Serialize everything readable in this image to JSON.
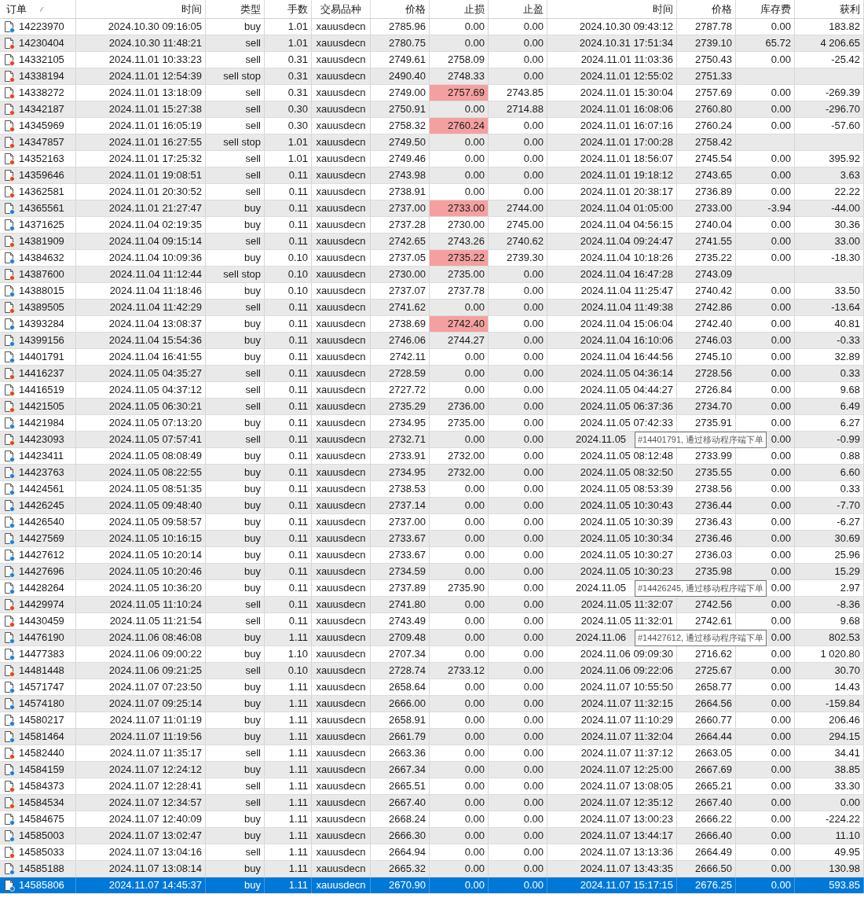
{
  "columns": [
    {
      "label": "订单"
    },
    {
      "label": "时间"
    },
    {
      "label": "类型"
    },
    {
      "label": "手数"
    },
    {
      "label": "交易品种"
    },
    {
      "label": "价格"
    },
    {
      "label": "止损"
    },
    {
      "label": "止盈"
    },
    {
      "label": "时间"
    },
    {
      "label": "价格"
    },
    {
      "label": "库存费"
    },
    {
      "label": "获利"
    }
  ],
  "rows": [
    {
      "kind": "buy",
      "selected": false,
      "sl_hit": false,
      "order": "14223970",
      "open_time": "2024.10.30 09:16:05",
      "type": "buy",
      "volume": "1.01",
      "symbol": "xauusdecn",
      "open_price": "2785.96",
      "sl": "0.00",
      "tp": "0.00",
      "close_time": "2024.10.30 09:43:12",
      "close_price": "2787.78",
      "swap": "0.00",
      "profit": "183.82"
    },
    {
      "kind": "sell",
      "selected": false,
      "sl_hit": false,
      "order": "14230404",
      "open_time": "2024.10.30 11:48:21",
      "type": "sell",
      "volume": "1.01",
      "symbol": "xauusdecn",
      "open_price": "2780.75",
      "sl": "0.00",
      "tp": "0.00",
      "close_time": "2024.10.31 17:51:34",
      "close_price": "2739.10",
      "swap": "65.72",
      "profit": "4 206.65"
    },
    {
      "kind": "sell",
      "selected": false,
      "sl_hit": false,
      "order": "14332105",
      "open_time": "2024.11.01 10:33:23",
      "type": "sell",
      "volume": "0.31",
      "symbol": "xauusdecn",
      "open_price": "2749.61",
      "sl": "2758.09",
      "tp": "0.00",
      "close_time": "2024.11.01 11:03:36",
      "close_price": "2750.43",
      "swap": "0.00",
      "profit": "-25.42"
    },
    {
      "kind": "sell",
      "selected": false,
      "sl_hit": false,
      "order": "14338194",
      "open_time": "2024.11.01 12:54:39",
      "type": "sell stop",
      "volume": "0.31",
      "symbol": "xauusdecn",
      "open_price": "2490.40",
      "sl": "2748.33",
      "tp": "0.00",
      "close_time": "2024.11.01 12:55:02",
      "close_price": "2751.33"
    },
    {
      "kind": "sell",
      "selected": false,
      "sl_hit": true,
      "order": "14338272",
      "open_time": "2024.11.01 13:18:09",
      "type": "sell",
      "volume": "0.31",
      "symbol": "xauusdecn",
      "open_price": "2749.00",
      "sl": "2757.69",
      "tp": "2743.85",
      "close_time": "2024.11.01 15:30:04",
      "close_price": "2757.69",
      "swap": "0.00",
      "profit": "-269.39"
    },
    {
      "kind": "sell",
      "selected": false,
      "sl_hit": false,
      "order": "14342187",
      "open_time": "2024.11.01 15:27:38",
      "type": "sell",
      "volume": "0.30",
      "symbol": "xauusdecn",
      "open_price": "2750.91",
      "sl": "0.00",
      "tp": "2714.88",
      "close_time": "2024.11.01 16:08:06",
      "close_price": "2760.80",
      "swap": "0.00",
      "profit": "-296.70"
    },
    {
      "kind": "sell",
      "selected": false,
      "sl_hit": true,
      "order": "14345969",
      "open_time": "2024.11.01 16:05:19",
      "type": "sell",
      "volume": "0.30",
      "symbol": "xauusdecn",
      "open_price": "2758.32",
      "sl": "2760.24",
      "tp": "0.00",
      "close_time": "2024.11.01 16:07:16",
      "close_price": "2760.24",
      "swap": "0.00",
      "profit": "-57.60"
    },
    {
      "kind": "sell",
      "selected": false,
      "sl_hit": false,
      "order": "14347857",
      "open_time": "2024.11.01 16:27:55",
      "type": "sell stop",
      "volume": "1.01",
      "symbol": "xauusdecn",
      "open_price": "2749.50",
      "sl": "0.00",
      "tp": "0.00",
      "close_time": "2024.11.01 17:00:28",
      "close_price": "2758.42"
    },
    {
      "kind": "sell",
      "selected": false,
      "sl_hit": false,
      "order": "14352163",
      "open_time": "2024.11.01 17:25:32",
      "type": "sell",
      "volume": "1.01",
      "symbol": "xauusdecn",
      "open_price": "2749.46",
      "sl": "0.00",
      "tp": "0.00",
      "close_time": "2024.11.01 18:56:07",
      "close_price": "2745.54",
      "swap": "0.00",
      "profit": "395.92"
    },
    {
      "kind": "sell",
      "selected": false,
      "sl_hit": false,
      "order": "14359646",
      "open_time": "2024.11.01 19:08:51",
      "type": "sell",
      "volume": "0.11",
      "symbol": "xauusdecn",
      "open_price": "2743.98",
      "sl": "0.00",
      "tp": "0.00",
      "close_time": "2024.11.01 19:18:12",
      "close_price": "2743.65",
      "swap": "0.00",
      "profit": "3.63"
    },
    {
      "kind": "sell",
      "selected": false,
      "sl_hit": false,
      "order": "14362581",
      "open_time": "2024.11.01 20:30:52",
      "type": "sell",
      "volume": "0.11",
      "symbol": "xauusdecn",
      "open_price": "2738.91",
      "sl": "0.00",
      "tp": "0.00",
      "close_time": "2024.11.01 20:38:17",
      "close_price": "2736.89",
      "swap": "0.00",
      "profit": "22.22"
    },
    {
      "kind": "buy",
      "selected": false,
      "sl_hit": true,
      "order": "14365561",
      "open_time": "2024.11.01 21:27:47",
      "type": "buy",
      "volume": "0.11",
      "symbol": "xauusdecn",
      "open_price": "2737.00",
      "sl": "2733.00",
      "tp": "2744.00",
      "close_time": "2024.11.04 01:05:00",
      "close_price": "2733.00",
      "swap": "-3.94",
      "profit": "-44.00"
    },
    {
      "kind": "buy",
      "selected": false,
      "sl_hit": false,
      "order": "14371625",
      "open_time": "2024.11.04 02:19:35",
      "type": "buy",
      "volume": "0.11",
      "symbol": "xauusdecn",
      "open_price": "2737.28",
      "sl": "2730.00",
      "tp": "2745.00",
      "close_time": "2024.11.04 04:56:15",
      "close_price": "2740.04",
      "swap": "0.00",
      "profit": "30.36"
    },
    {
      "kind": "sell",
      "selected": false,
      "sl_hit": false,
      "order": "14381909",
      "open_time": "2024.11.04 09:15:14",
      "type": "sell",
      "volume": "0.11",
      "symbol": "xauusdecn",
      "open_price": "2742.65",
      "sl": "2743.26",
      "tp": "2740.62",
      "close_time": "2024.11.04 09:24:47",
      "close_price": "2741.55",
      "swap": "0.00",
      "profit": "33.00"
    },
    {
      "kind": "buy",
      "selected": false,
      "sl_hit": true,
      "order": "14384632",
      "open_time": "2024.11.04 10:09:36",
      "type": "buy",
      "volume": "0.10",
      "symbol": "xauusdecn",
      "open_price": "2737.05",
      "sl": "2735.22",
      "tp": "2739.30",
      "close_time": "2024.11.04 10:18:26",
      "close_price": "2735.22",
      "swap": "0.00",
      "profit": "-18.30"
    },
    {
      "kind": "sell",
      "selected": false,
      "sl_hit": false,
      "order": "14387600",
      "open_time": "2024.11.04 11:12:44",
      "type": "sell stop",
      "volume": "0.10",
      "symbol": "xauusdecn",
      "open_price": "2730.00",
      "sl": "2735.00",
      "tp": "0.00",
      "close_time": "2024.11.04 16:47:28",
      "close_price": "2743.09"
    },
    {
      "kind": "buy",
      "selected": false,
      "sl_hit": false,
      "order": "14388015",
      "open_time": "2024.11.04 11:18:46",
      "type": "buy",
      "volume": "0.10",
      "symbol": "xauusdecn",
      "open_price": "2737.07",
      "sl": "2737.78",
      "tp": "0.00",
      "close_time": "2024.11.04 11:25:47",
      "close_price": "2740.42",
      "swap": "0.00",
      "profit": "33.50"
    },
    {
      "kind": "sell",
      "selected": false,
      "sl_hit": false,
      "order": "14389505",
      "open_time": "2024.11.04 11:42:29",
      "type": "sell",
      "volume": "0.11",
      "symbol": "xauusdecn",
      "open_price": "2741.62",
      "sl": "0.00",
      "tp": "0.00",
      "close_time": "2024.11.04 11:49:38",
      "close_price": "2742.86",
      "swap": "0.00",
      "profit": "-13.64"
    },
    {
      "kind": "buy",
      "selected": false,
      "sl_hit": true,
      "order": "14393284",
      "open_time": "2024.11.04 13:08:37",
      "type": "buy",
      "volume": "0.11",
      "symbol": "xauusdecn",
      "open_price": "2738.69",
      "sl": "2742.40",
      "tp": "0.00",
      "close_time": "2024.11.04 15:06:04",
      "close_price": "2742.40",
      "swap": "0.00",
      "profit": "40.81"
    },
    {
      "kind": "buy",
      "selected": false,
      "sl_hit": false,
      "order": "14399156",
      "open_time": "2024.11.04 15:54:36",
      "type": "buy",
      "volume": "0.11",
      "symbol": "xauusdecn",
      "open_price": "2746.06",
      "sl": "2744.27",
      "tp": "0.00",
      "close_time": "2024.11.04 16:10:06",
      "close_price": "2746.03",
      "swap": "0.00",
      "profit": "-0.33"
    },
    {
      "kind": "buy",
      "selected": false,
      "sl_hit": false,
      "order": "14401791",
      "open_time": "2024.11.04 16:41:55",
      "type": "buy",
      "volume": "0.11",
      "symbol": "xauusdecn",
      "open_price": "2742.11",
      "sl": "0.00",
      "tp": "0.00",
      "close_time": "2024.11.04 16:44:56",
      "close_price": "2745.10",
      "swap": "0.00",
      "profit": "32.89"
    },
    {
      "kind": "sell",
      "selected": false,
      "sl_hit": false,
      "order": "14416237",
      "open_time": "2024.11.05 04:35:27",
      "type": "sell",
      "volume": "0.11",
      "symbol": "xauusdecn",
      "open_price": "2728.59",
      "sl": "0.00",
      "tp": "0.00",
      "close_time": "2024.11.05 04:36:14",
      "close_price": "2728.56",
      "swap": "0.00",
      "profit": "0.33"
    },
    {
      "kind": "sell",
      "selected": false,
      "sl_hit": false,
      "order": "14416519",
      "open_time": "2024.11.05 04:37:12",
      "type": "sell",
      "volume": "0.11",
      "symbol": "xauusdecn",
      "open_price": "2727.72",
      "sl": "0.00",
      "tp": "0.00",
      "close_time": "2024.11.05 04:44:27",
      "close_price": "2726.84",
      "swap": "0.00",
      "profit": "9.68"
    },
    {
      "kind": "sell",
      "selected": false,
      "sl_hit": false,
      "order": "14421505",
      "open_time": "2024.11.05 06:30:21",
      "type": "sell",
      "volume": "0.11",
      "symbol": "xauusdecn",
      "open_price": "2735.29",
      "sl": "2736.00",
      "tp": "0.00",
      "close_time": "2024.11.05 06:37:36",
      "close_price": "2734.70",
      "swap": "0.00",
      "profit": "6.49"
    },
    {
      "kind": "buy",
      "selected": false,
      "sl_hit": false,
      "order": "14421984",
      "open_time": "2024.11.05 07:13:20",
      "type": "buy",
      "volume": "0.11",
      "symbol": "xauusdecn",
      "open_price": "2734.95",
      "sl": "2735.00",
      "tp": "0.00",
      "close_time": "2024.11.05 07:42:33",
      "close_price": "2735.91",
      "swap": "0.00",
      "profit": "6.27"
    },
    {
      "kind": "sell",
      "selected": false,
      "sl_hit": false,
      "order": "14423093",
      "open_time": "2024.11.05 07:57:41",
      "type": "sell",
      "volume": "0.11",
      "symbol": "xauusdecn",
      "open_price": "2732.71",
      "sl": "0.00",
      "tp": "0.00",
      "close_time": "2024.11.05",
      "swap": "0.00",
      "profit": "-0.99",
      "tooltip": "#14401791, 通过移动程序端下单"
    },
    {
      "kind": "buy",
      "selected": false,
      "sl_hit": false,
      "order": "14423411",
      "open_time": "2024.11.05 08:08:49",
      "type": "buy",
      "volume": "0.11",
      "symbol": "xauusdecn",
      "open_price": "2733.91",
      "sl": "2732.00",
      "tp": "0.00",
      "close_time": "2024.11.05 08:12:48",
      "close_price": "2733.99",
      "swap": "0.00",
      "profit": "0.88"
    },
    {
      "kind": "buy",
      "selected": false,
      "sl_hit": false,
      "order": "14423763",
      "open_time": "2024.11.05 08:22:55",
      "type": "buy",
      "volume": "0.11",
      "symbol": "xauusdecn",
      "open_price": "2734.95",
      "sl": "2732.00",
      "tp": "0.00",
      "close_time": "2024.11.05 08:32:50",
      "close_price": "2735.55",
      "swap": "0.00",
      "profit": "6.60"
    },
    {
      "kind": "buy",
      "selected": false,
      "sl_hit": false,
      "order": "14424561",
      "open_time": "2024.11.05 08:51:35",
      "type": "buy",
      "volume": "0.11",
      "symbol": "xauusdecn",
      "open_price": "2738.53",
      "sl": "0.00",
      "tp": "0.00",
      "close_time": "2024.11.05 08:53:39",
      "close_price": "2738.56",
      "swap": "0.00",
      "profit": "0.33"
    },
    {
      "kind": "buy",
      "selected": false,
      "sl_hit": false,
      "order": "14426245",
      "open_time": "2024.11.05 09:48:40",
      "type": "buy",
      "volume": "0.11",
      "symbol": "xauusdecn",
      "open_price": "2737.14",
      "sl": "0.00",
      "tp": "0.00",
      "close_time": "2024.11.05 10:30:43",
      "close_price": "2736.44",
      "swap": "0.00",
      "profit": "-7.70"
    },
    {
      "kind": "buy",
      "selected": false,
      "sl_hit": false,
      "order": "14426540",
      "open_time": "2024.11.05 09:58:57",
      "type": "buy",
      "volume": "0.11",
      "symbol": "xauusdecn",
      "open_price": "2737.00",
      "sl": "0.00",
      "tp": "0.00",
      "close_time": "2024.11.05 10:30:39",
      "close_price": "2736.43",
      "swap": "0.00",
      "profit": "-6.27"
    },
    {
      "kind": "buy",
      "selected": false,
      "sl_hit": false,
      "order": "14427569",
      "open_time": "2024.11.05 10:16:15",
      "type": "buy",
      "volume": "0.11",
      "symbol": "xauusdecn",
      "open_price": "2733.67",
      "sl": "0.00",
      "tp": "0.00",
      "close_time": "2024.11.05 10:30:34",
      "close_price": "2736.46",
      "swap": "0.00",
      "profit": "30.69"
    },
    {
      "kind": "buy",
      "selected": false,
      "sl_hit": false,
      "order": "14427612",
      "open_time": "2024.11.05 10:20:14",
      "type": "buy",
      "volume": "0.11",
      "symbol": "xauusdecn",
      "open_price": "2733.67",
      "sl": "0.00",
      "tp": "0.00",
      "close_time": "2024.11.05 10:30:27",
      "close_price": "2736.03",
      "swap": "0.00",
      "profit": "25.96"
    },
    {
      "kind": "buy",
      "selected": false,
      "sl_hit": false,
      "order": "14427696",
      "open_time": "2024.11.05 10:20:46",
      "type": "buy",
      "volume": "0.11",
      "symbol": "xauusdecn",
      "open_price": "2734.59",
      "sl": "0.00",
      "tp": "0.00",
      "close_time": "2024.11.05 10:30:23",
      "close_price": "2735.98",
      "swap": "0.00",
      "profit": "15.29"
    },
    {
      "kind": "buy",
      "selected": false,
      "sl_hit": false,
      "order": "14428264",
      "open_time": "2024.11.05 10:36:20",
      "type": "buy",
      "volume": "0.11",
      "symbol": "xauusdecn",
      "open_price": "2737.89",
      "sl": "2735.90",
      "tp": "0.00",
      "close_time": "2024.11.05",
      "swap": "0.00",
      "profit": "2.97",
      "tooltip": "#14426245, 通过移动程序端下单"
    },
    {
      "kind": "sell",
      "selected": false,
      "sl_hit": false,
      "order": "14429974",
      "open_time": "2024.11.05 11:10:24",
      "type": "sell",
      "volume": "0.11",
      "symbol": "xauusdecn",
      "open_price": "2741.80",
      "sl": "0.00",
      "tp": "0.00",
      "close_time": "2024.11.05 11:32:07",
      "close_price": "2742.56",
      "swap": "0.00",
      "profit": "-8.36"
    },
    {
      "kind": "sell",
      "selected": false,
      "sl_hit": false,
      "order": "14430459",
      "open_time": "2024.11.05 11:21:54",
      "type": "sell",
      "volume": "0.11",
      "symbol": "xauusdecn",
      "open_price": "2743.49",
      "sl": "0.00",
      "tp": "0.00",
      "close_time": "2024.11.05 11:32:01",
      "close_price": "2742.61",
      "swap": "0.00",
      "profit": "9.68"
    },
    {
      "kind": "buy",
      "selected": false,
      "sl_hit": false,
      "order": "14476190",
      "open_time": "2024.11.06 08:46:08",
      "type": "buy",
      "volume": "1.11",
      "symbol": "xauusdecn",
      "open_price": "2709.48",
      "sl": "0.00",
      "tp": "0.00",
      "close_time": "2024.11.06",
      "swap": "0.00",
      "profit": "802.53",
      "tooltip": "#14427612, 通过移动程序端下单"
    },
    {
      "kind": "buy",
      "selected": false,
      "sl_hit": false,
      "order": "14477383",
      "open_time": "2024.11.06 09:00:22",
      "type": "buy",
      "volume": "1.10",
      "symbol": "xauusdecn",
      "open_price": "2707.34",
      "sl": "0.00",
      "tp": "0.00",
      "close_time": "2024.11.06 09:09:30",
      "close_price": "2716.62",
      "swap": "0.00",
      "profit": "1 020.80"
    },
    {
      "kind": "sell",
      "selected": false,
      "sl_hit": false,
      "order": "14481448",
      "open_time": "2024.11.06 09:21:25",
      "type": "sell",
      "volume": "0.10",
      "symbol": "xauusdecn",
      "open_price": "2728.74",
      "sl": "2733.12",
      "tp": "0.00",
      "close_time": "2024.11.06 09:22:06",
      "close_price": "2725.67",
      "swap": "0.00",
      "profit": "30.70"
    },
    {
      "kind": "buy",
      "selected": false,
      "sl_hit": false,
      "order": "14571747",
      "open_time": "2024.11.07 07:23:50",
      "type": "buy",
      "volume": "1.11",
      "symbol": "xauusdecn",
      "open_price": "2658.64",
      "sl": "0.00",
      "tp": "0.00",
      "close_time": "2024.11.07 10:55:50",
      "close_price": "2658.77",
      "swap": "0.00",
      "profit": "14.43"
    },
    {
      "kind": "buy",
      "selected": false,
      "sl_hit": false,
      "order": "14574180",
      "open_time": "2024.11.07 09:25:14",
      "type": "buy",
      "volume": "1.11",
      "symbol": "xauusdecn",
      "open_price": "2666.00",
      "sl": "0.00",
      "tp": "0.00",
      "close_time": "2024.11.07 11:32:15",
      "close_price": "2664.56",
      "swap": "0.00",
      "profit": "-159.84"
    },
    {
      "kind": "buy",
      "selected": false,
      "sl_hit": false,
      "order": "14580217",
      "open_time": "2024.11.07 11:01:19",
      "type": "buy",
      "volume": "1.11",
      "symbol": "xauusdecn",
      "open_price": "2658.91",
      "sl": "0.00",
      "tp": "0.00",
      "close_time": "2024.11.07 11:10:29",
      "close_price": "2660.77",
      "swap": "0.00",
      "profit": "206.46"
    },
    {
      "kind": "buy",
      "selected": false,
      "sl_hit": false,
      "order": "14581464",
      "open_time": "2024.11.07 11:19:56",
      "type": "buy",
      "volume": "1.11",
      "symbol": "xauusdecn",
      "open_price": "2661.79",
      "sl": "0.00",
      "tp": "0.00",
      "close_time": "2024.11.07 11:32:04",
      "close_price": "2664.44",
      "swap": "0.00",
      "profit": "294.15"
    },
    {
      "kind": "sell",
      "selected": false,
      "sl_hit": false,
      "order": "14582440",
      "open_time": "2024.11.07 11:35:17",
      "type": "sell",
      "volume": "1.11",
      "symbol": "xauusdecn",
      "open_price": "2663.36",
      "sl": "0.00",
      "tp": "0.00",
      "close_time": "2024.11.07 11:37:12",
      "close_price": "2663.05",
      "swap": "0.00",
      "profit": "34.41"
    },
    {
      "kind": "buy",
      "selected": false,
      "sl_hit": false,
      "order": "14584159",
      "open_time": "2024.11.07 12:24:12",
      "type": "buy",
      "volume": "1.11",
      "symbol": "xauusdecn",
      "open_price": "2667.34",
      "sl": "0.00",
      "tp": "0.00",
      "close_time": "2024.11.07 12:25:00",
      "close_price": "2667.69",
      "swap": "0.00",
      "profit": "38.85"
    },
    {
      "kind": "sell",
      "selected": false,
      "sl_hit": false,
      "order": "14584373",
      "open_time": "2024.11.07 12:28:41",
      "type": "sell",
      "volume": "1.11",
      "symbol": "xauusdecn",
      "open_price": "2665.51",
      "sl": "0.00",
      "tp": "0.00",
      "close_time": "2024.11.07 13:08:05",
      "close_price": "2665.21",
      "swap": "0.00",
      "profit": "33.30"
    },
    {
      "kind": "sell",
      "selected": false,
      "sl_hit": false,
      "order": "14584534",
      "open_time": "2024.11.07 12:34:57",
      "type": "sell",
      "volume": "1.11",
      "symbol": "xauusdecn",
      "open_price": "2667.40",
      "sl": "0.00",
      "tp": "0.00",
      "close_time": "2024.11.07 12:35:12",
      "close_price": "2667.40",
      "swap": "0.00",
      "profit": "0.00"
    },
    {
      "kind": "buy",
      "selected": false,
      "sl_hit": false,
      "order": "14584675",
      "open_time": "2024.11.07 12:40:09",
      "type": "buy",
      "volume": "1.11",
      "symbol": "xauusdecn",
      "open_price": "2668.24",
      "sl": "0.00",
      "tp": "0.00",
      "close_time": "2024.11.07 13:00:23",
      "close_price": "2666.22",
      "swap": "0.00",
      "profit": "-224.22"
    },
    {
      "kind": "buy",
      "selected": false,
      "sl_hit": false,
      "order": "14585003",
      "open_time": "2024.11.07 13:02:47",
      "type": "buy",
      "volume": "1.11",
      "symbol": "xauusdecn",
      "open_price": "2666.30",
      "sl": "0.00",
      "tp": "0.00",
      "close_time": "2024.11.07 13:44:17",
      "close_price": "2666.40",
      "swap": "0.00",
      "profit": "11.10"
    },
    {
      "kind": "sell",
      "selected": false,
      "sl_hit": false,
      "order": "14585033",
      "open_time": "2024.11.07 13:04:16",
      "type": "sell",
      "volume": "1.11",
      "symbol": "xauusdecn",
      "open_price": "2664.94",
      "sl": "0.00",
      "tp": "0.00",
      "close_time": "2024.11.07 13:13:36",
      "close_price": "2664.49",
      "swap": "0.00",
      "profit": "49.95"
    },
    {
      "kind": "buy",
      "selected": false,
      "sl_hit": false,
      "order": "14585188",
      "open_time": "2024.11.07 13:08:14",
      "type": "buy",
      "volume": "1.11",
      "symbol": "xauusdecn",
      "open_price": "2665.32",
      "sl": "0.00",
      "tp": "0.00",
      "close_time": "2024.11.07 13:43:35",
      "close_price": "2666.50",
      "swap": "0.00",
      "profit": "130.98"
    },
    {
      "kind": "buy",
      "selected": true,
      "sl_hit": false,
      "order": "14585806",
      "open_time": "2024.11.07 14:45:37",
      "type": "buy",
      "volume": "1.11",
      "symbol": "xauusdecn",
      "open_price": "2670.90",
      "sl": "0.00",
      "tp": "0.00",
      "close_time": "2024.11.07 15:17:15",
      "close_price": "2676.25",
      "swap": "0.00",
      "profit": "593.85"
    }
  ]
}
